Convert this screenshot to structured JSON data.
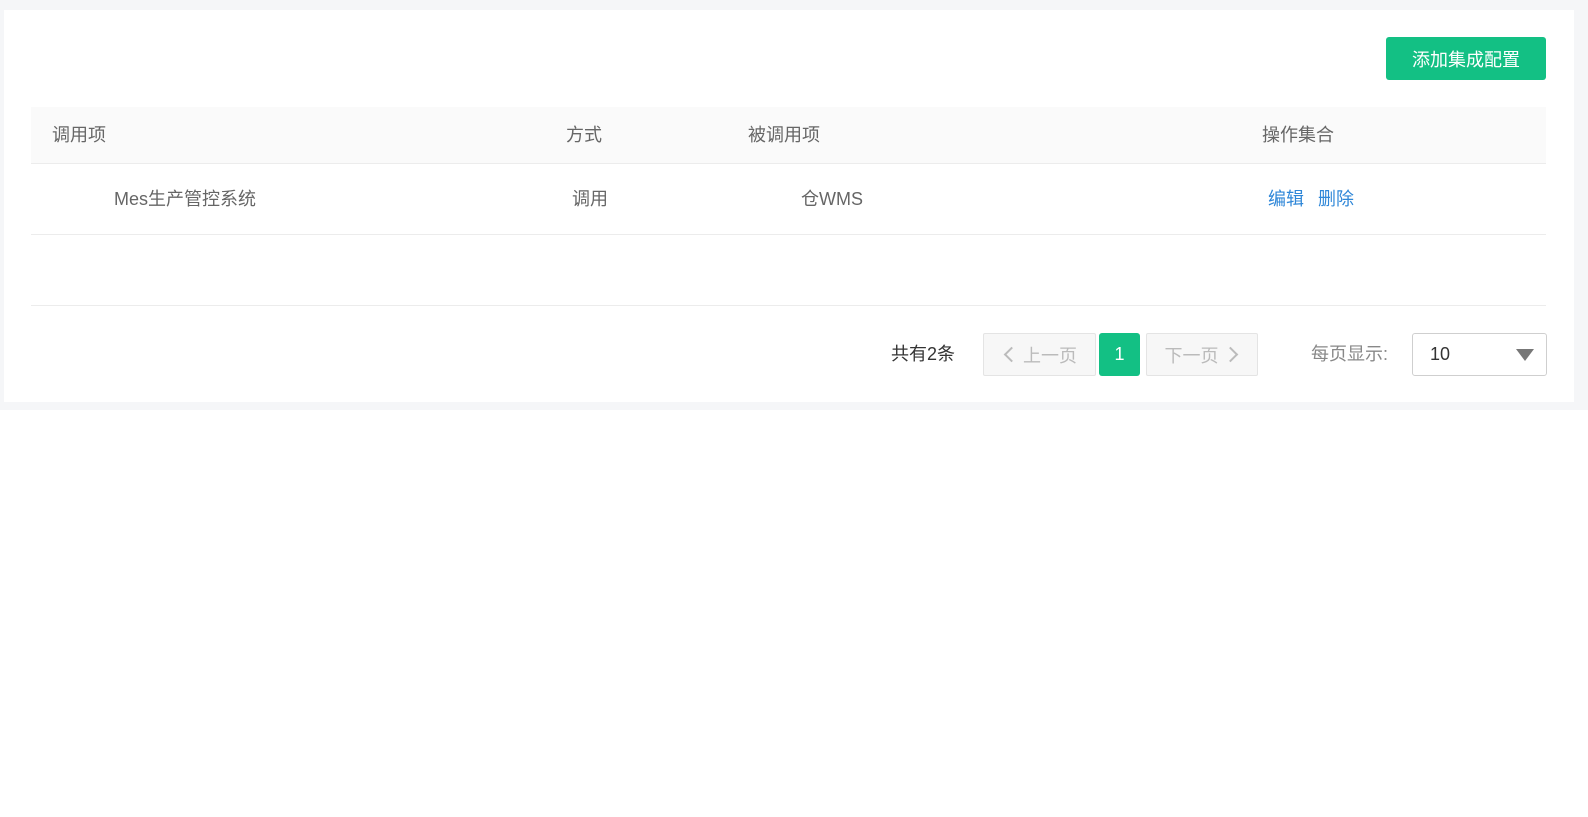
{
  "toolbar": {
    "add_label": "添加集成配置"
  },
  "table": {
    "columns": [
      "调用项",
      "方式",
      "被调用项",
      "操作集合"
    ],
    "rows": [
      {
        "caller": "Mes生产管控系统",
        "method": "调用",
        "callee": "仓WMS",
        "edit": "编辑",
        "delete": "删除"
      }
    ]
  },
  "pagination": {
    "total": "共有2条",
    "prev": "上一页",
    "current": "1",
    "next": "下一页",
    "page_size_label": "每页显示:",
    "page_size": "10"
  },
  "colors": {
    "accent": "#13c084",
    "link": "#2f87d8"
  }
}
